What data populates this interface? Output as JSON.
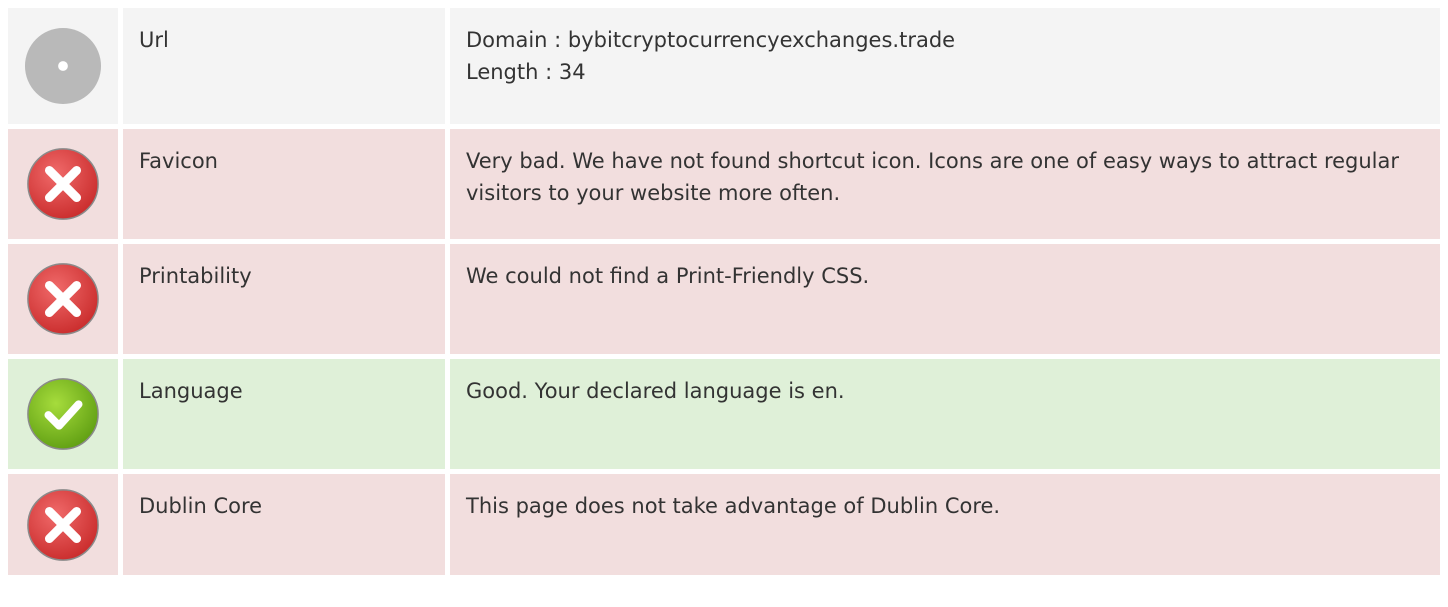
{
  "rows": [
    {
      "status": "neutral",
      "icon": "info-circle-gray-icon",
      "label": "Url",
      "lines": [
        "Domain : bybitcryptocurrencyexchanges.trade",
        "Length : 34"
      ]
    },
    {
      "status": "bad",
      "icon": "error-x-icon",
      "label": "Favicon",
      "lines": [
        "Very bad. We have not found shortcut icon. Icons are one of easy ways to attract regular visitors to your website more often."
      ]
    },
    {
      "status": "bad",
      "icon": "error-x-icon",
      "label": "Printability",
      "lines": [
        "We could not find a Print-Friendly CSS."
      ]
    },
    {
      "status": "good",
      "icon": "check-circle-icon",
      "label": "Language",
      "lines": [
        "Good. Your declared language is en."
      ]
    },
    {
      "status": "bad",
      "icon": "error-x-icon",
      "label": "Dublin Core",
      "lines": [
        "This page does not take advantage of Dublin Core."
      ]
    }
  ],
  "colors": {
    "neutral_bg": "#f4f4f4",
    "bad_bg": "#f2dede",
    "good_bg": "#dff0d8",
    "error_red": "#e53d3d",
    "success_green": "#7fbf1e",
    "neutral_gray": "#b9b9b9"
  }
}
